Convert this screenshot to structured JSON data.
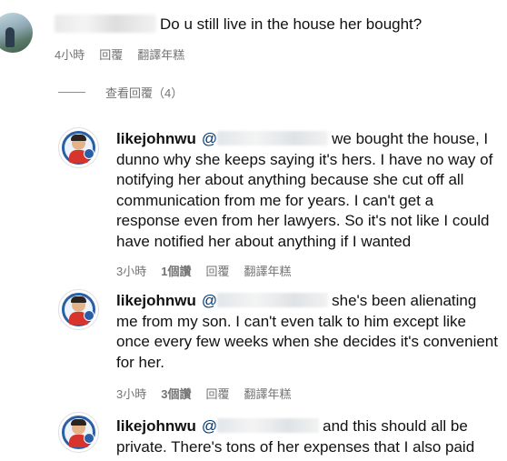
{
  "top_comment": {
    "text": "Do u still live in the house her bought?",
    "time": "4小時",
    "reply_label": "回覆",
    "translate_label": "翻譯年糕"
  },
  "view_replies": {
    "label": "查看回覆（4）"
  },
  "replies": [
    {
      "username": "likejohnwu",
      "mention": "@",
      "text": "we bought the house, I dunno why she keeps saying it's hers. I have no way of notifying her about anything because she cut off all communication from me for years. I can't get a response even from her lawyers. So it's not like I could have notified her about anything if I wanted",
      "time": "3小時",
      "likes": "1個讚",
      "reply_label": "回覆",
      "translate_label": "翻譯年糕"
    },
    {
      "username": "likejohnwu",
      "mention": "@",
      "text": "she's been alienating me from my son. I can't even talk to him except like once every few weeks when she decides it's convenient for her.",
      "time": "3小時",
      "likes": "3個讚",
      "reply_label": "回覆",
      "translate_label": "翻譯年糕"
    },
    {
      "username": "likejohnwu",
      "mention": "@",
      "text": "and this should all be private. There's tons of her expenses that I also paid",
      "time": "",
      "likes": "",
      "reply_label": "",
      "translate_label": ""
    }
  ],
  "colors": {
    "meta_gray": "#737373",
    "mention_blue": "#00376b",
    "text": "#111111"
  }
}
